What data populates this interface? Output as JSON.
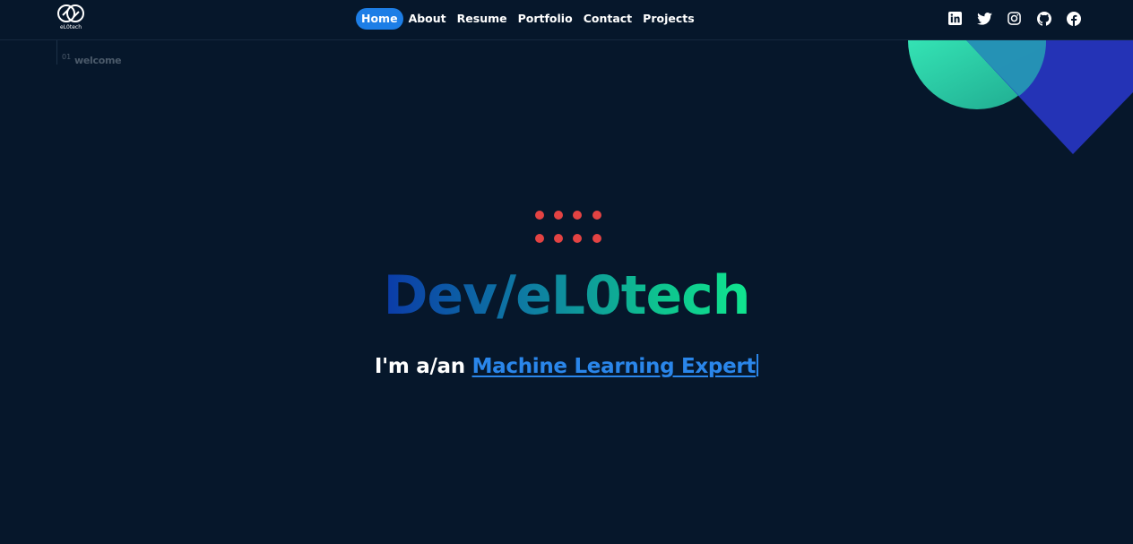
{
  "brand": {
    "logo_text": "eL0tech"
  },
  "nav": {
    "items": [
      {
        "label": "Home",
        "active": true
      },
      {
        "label": "About",
        "active": false
      },
      {
        "label": "Resume",
        "active": false
      },
      {
        "label": "Portfolio",
        "active": false
      },
      {
        "label": "Contact",
        "active": false
      },
      {
        "label": "Projects",
        "active": false
      }
    ]
  },
  "social": [
    "linkedin-icon",
    "twitter-icon",
    "instagram-icon",
    "github-icon",
    "facebook-icon"
  ],
  "section": {
    "number": "01",
    "label": "welcome"
  },
  "hero": {
    "title": "Dev/eL0tech",
    "prefix": "I'm a/an ",
    "typed_text": "Machine Learning Expert"
  },
  "colors": {
    "background": "#06172b",
    "accent": "#1d7ee6",
    "dots": "#e34343",
    "gradient_start": "#0b3aa8",
    "gradient_end": "#10e68f"
  }
}
